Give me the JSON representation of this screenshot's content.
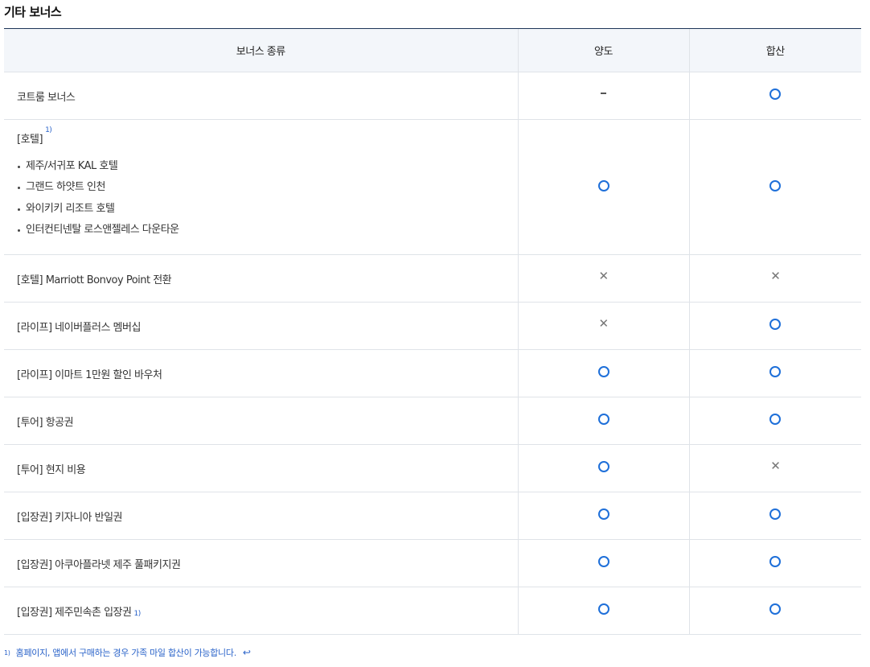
{
  "section_title": "기타 보너스",
  "table": {
    "headers": [
      "보너스 종류",
      "양도",
      "합산"
    ],
    "rows": [
      {
        "name": "코트룸 보너스",
        "transfer": "-",
        "combine": "O"
      },
      {
        "name": "[호텔]",
        "footnote": "1)",
        "items": [
          "제주/서귀포 KAL 호텔",
          "그랜드 하얏트 인천",
          "와이키키 리조트 호텔",
          "인터컨티넨탈 로스앤젤레스 다운타운"
        ],
        "transfer": "O",
        "combine": "O"
      },
      {
        "name": "[호텔] Marriott Bonvoy Point 전환",
        "transfer": "X",
        "combine": "X"
      },
      {
        "name": "[라이프] 네이버플러스 멤버십",
        "transfer": "X",
        "combine": "O"
      },
      {
        "name": "[라이프] 이마트 1만원 할인 바우처",
        "transfer": "O",
        "combine": "O"
      },
      {
        "name": "[투어] 항공권",
        "transfer": "O",
        "combine": "O"
      },
      {
        "name": "[투어] 현지 비용",
        "transfer": "O",
        "combine": "X"
      },
      {
        "name": "[입장권] 키자니아 반일권",
        "transfer": "O",
        "combine": "O"
      },
      {
        "name": "[입장권] 아쿠아플라넷 제주 풀패키지권",
        "transfer": "O",
        "combine": "O"
      },
      {
        "name": "[입장권] 제주민속촌 입장권",
        "footnote": "1)",
        "transfer": "O",
        "combine": "O"
      }
    ]
  },
  "footnote": {
    "number": "1)",
    "text": "홈페이지, 앱에서 구매하는 경우 가족 마일 합산이 가능합니다.",
    "back_icon": "return-arrow-icon",
    "back_glyph": "↩"
  },
  "mark_icons": {
    "O": "circle-icon",
    "X": "cross-icon",
    "-": "dash-icon"
  },
  "colors": {
    "circle": "#1e6fd9",
    "header_bg": "#f3f6fa",
    "top_border": "#1d3557",
    "footnote": "#2a63c9"
  }
}
